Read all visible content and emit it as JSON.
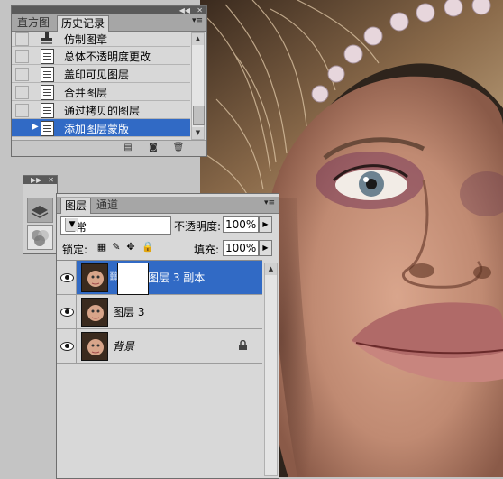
{
  "history_panel": {
    "tabs": [
      "直方图",
      "历史记录"
    ],
    "active_tab": "历史记录",
    "items": [
      {
        "label": "仿制图章",
        "icon": "stamp-icon",
        "selected": false
      },
      {
        "label": "总体不透明度更改",
        "icon": "history-state-icon",
        "selected": false
      },
      {
        "label": "盖印可见图层",
        "icon": "history-state-icon",
        "selected": false
      },
      {
        "label": "合并图层",
        "icon": "history-state-icon",
        "selected": false
      },
      {
        "label": "通过拷贝的图层",
        "icon": "history-state-icon",
        "selected": false
      },
      {
        "label": "添加图层蒙版",
        "icon": "history-state-icon",
        "selected": true
      }
    ],
    "footer_icons": [
      "new-document-from-state-icon",
      "snapshot-camera-icon",
      "trash-icon"
    ]
  },
  "tools_panel": {
    "buttons": [
      "layers-stack-icon",
      "channels-rgb-icon"
    ]
  },
  "layers_panel": {
    "tabs": [
      "图层",
      "通道"
    ],
    "active_tab": "图层",
    "blend_mode": "正常",
    "opacity_label": "不透明度:",
    "opacity_value": "100%",
    "lock_label": "锁定:",
    "fill_label": "填充:",
    "fill_value": "100%",
    "layers": [
      {
        "name": "图层 3 副本",
        "visible": true,
        "selected": true,
        "has_mask": true,
        "locked": false,
        "italic": false
      },
      {
        "name": "图层 3",
        "visible": true,
        "selected": false,
        "has_mask": false,
        "locked": false,
        "italic": false
      },
      {
        "name": "背景",
        "visible": true,
        "selected": false,
        "has_mask": false,
        "locked": true,
        "italic": true
      }
    ]
  },
  "colors": {
    "selection": "#316ac5",
    "panel_bg": "#d8d8d8",
    "workspace": "#c4c4c4"
  }
}
